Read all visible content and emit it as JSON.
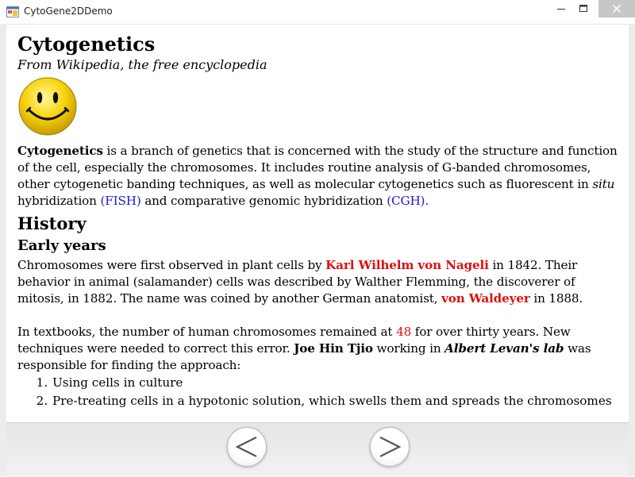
{
  "window": {
    "title": "CytoGene2DDemo",
    "icon": "app-window-icon",
    "controls": [
      "minimize-icon",
      "maximize-icon",
      "close-icon"
    ]
  },
  "article": {
    "title": "Cytogenetics",
    "subtitle": "From Wikipedia, the free encyclopedia",
    "image": "smiley-face-icon",
    "intro": {
      "term": "Cytogenetics",
      "text1": " is a branch of genetics that is concerned with the study of the structure and function of the cell, especially the chromosomes. It includes routine analysis of G-banded chromosomes, other cytogenetic banding techniques, as well as molecular cytogenetics such as fluorescent in ",
      "situ": "situ",
      "text2": " hybridization ",
      "fish": "(FISH)",
      "text3": " and comparative genomic hybridization ",
      "cgh": "(CGH)."
    },
    "history_heading": "History",
    "early_heading": "Early years",
    "para1": {
      "t1": "Chromosomes were first observed in plant cells by ",
      "nageli": "Karl Wilhelm von Nageli",
      "t2": " in 1842. Their behavior in animal (salamander) cells was described by Walther Flemming, the discoverer of mitosis, in 1882. The name was coined by another German anatomist, ",
      "waldeyer": "von Waldeyer",
      "t3": " in 1888."
    },
    "para2": {
      "t1": "In textbooks, the number of human chromosomes remained at ",
      "number": "48",
      "t2": " for over thirty years. New techniques were needed to correct this error. ",
      "tjio": "Joe Hin Tjio",
      "t3": " working in ",
      "levan": "Albert Levan's lab",
      "t4": " was responsible for finding the approach:"
    },
    "steps": [
      "Using cells in culture",
      "Pre-treating cells in a hypotonic solution, which swells them and spreads the chromosomes"
    ]
  },
  "toolbar": {
    "prev_icon": "chevron-left-icon",
    "next_icon": "chevron-right-icon"
  },
  "colors": {
    "link_blue": "#1a1acd",
    "highlight_red": "#e01010"
  }
}
